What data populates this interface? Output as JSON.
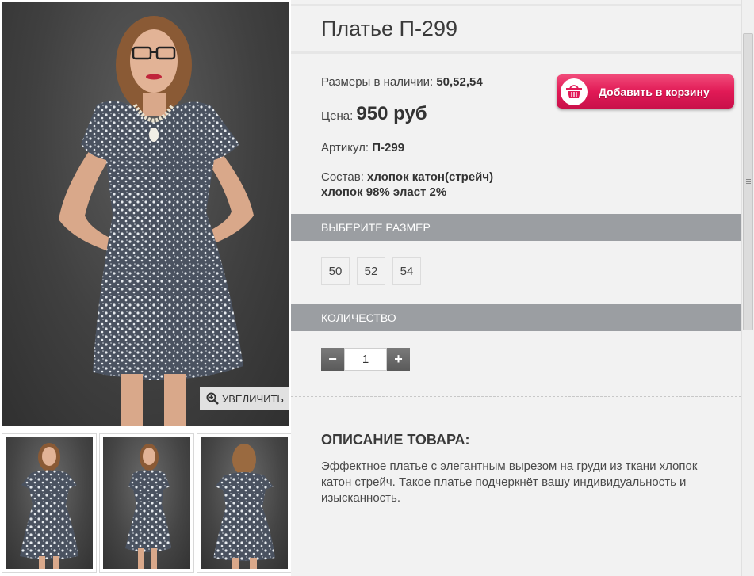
{
  "gallery": {
    "zoom_label": "УВЕЛИЧИТЬ",
    "thumbnail_count": 3
  },
  "product": {
    "title": "Платье П-299",
    "sizes_label": "Размеры в наличии:",
    "sizes_value": "50,52,54",
    "price_label": "Цена:",
    "price_value": "950 руб",
    "sku_label": "Артикул:",
    "sku_value": "П-299",
    "composition_label": "Состав:",
    "composition_line1": "хлопок катон(стрейч)",
    "composition_line2": "хлопок 98% эласт 2%"
  },
  "cart_button": {
    "label": "Добавить в корзину",
    "color": "#e11a56"
  },
  "size_section": {
    "heading": "ВЫБЕРИТЕ РАЗМЕР",
    "options": [
      "50",
      "52",
      "54"
    ]
  },
  "quantity_section": {
    "heading": "КОЛИЧЕСТВО",
    "minus": "−",
    "value": "1",
    "plus": "+"
  },
  "description": {
    "heading": "ОПИСАНИЕ ТОВАРА:",
    "text": "Эффектное платье с элегантным вырезом на груди из ткани хлопок катон стрейч. Такое платье подчеркнёт вашу индивидуальность и изысканность."
  },
  "colors": {
    "section_bar": "#9b9ea2",
    "panel_bg": "#f2f2f2",
    "photo_bg": "#404040",
    "dress_pattern": "#4a5260"
  }
}
